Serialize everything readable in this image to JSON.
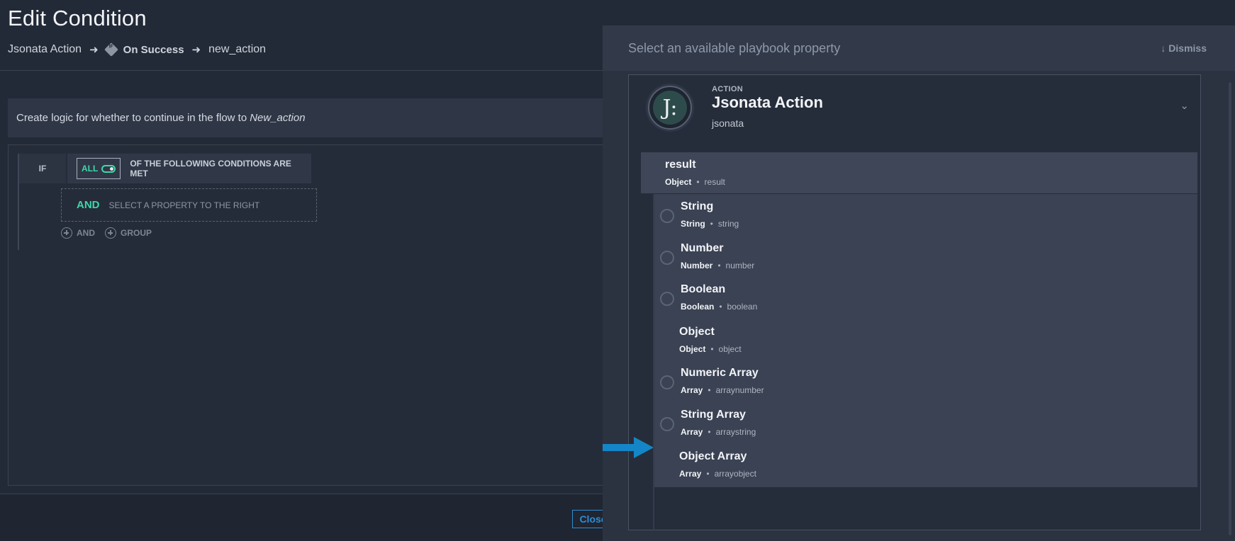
{
  "editor": {
    "title": "Edit Condition",
    "breadcrumb": {
      "source": "Jsonata Action",
      "sep1": "➜",
      "condition": "On Success",
      "sep2": "➜",
      "target": "new_action"
    },
    "intro_text": "Create logic for whether to continue in the flow to",
    "intro_target": "New_action",
    "if_label": "IF",
    "all_toggle_label": "ALL",
    "conditions_text": "OF THE FOLLOWING CONDITIONS ARE MET",
    "and_keyword": "AND",
    "and_hint": "SELECT A PROPERTY TO THE RIGHT",
    "add_and_label": "AND",
    "add_group_label": "GROUP",
    "close_label": "Close"
  },
  "panel": {
    "title": "Select an available playbook property",
    "dismiss_label": "↓ Dismiss",
    "action": {
      "kind": "ACTION",
      "name": "Jsonata Action",
      "id": "jsonata",
      "logo_glyph": "J:"
    },
    "root": {
      "name": "result",
      "type": "Object",
      "path": "result"
    },
    "properties": [
      {
        "name": "String",
        "type": "String",
        "path": "string",
        "selectable": true
      },
      {
        "name": "Number",
        "type": "Number",
        "path": "number",
        "selectable": true
      },
      {
        "name": "Boolean",
        "type": "Boolean",
        "path": "boolean",
        "selectable": true
      },
      {
        "name": "Object",
        "type": "Object",
        "path": "object",
        "selectable": false
      },
      {
        "name": "Numeric Array",
        "type": "Array",
        "path": "arraynumber",
        "selectable": true
      },
      {
        "name": "String Array",
        "type": "Array",
        "path": "arraystring",
        "selectable": true
      },
      {
        "name": "Object Array",
        "type": "Array",
        "path": "arrayobject",
        "selectable": false
      }
    ]
  },
  "colors": {
    "accent_green": "#3fd7a9",
    "accent_blue": "#2f8cd6",
    "pointer_arrow": "#1486c8"
  },
  "icons": {
    "breadcrumb_condition": "condition-diamond-icon",
    "add": "plus-circle-icon",
    "expand": "chevron-down-icon",
    "pointer": "arrow-right-icon"
  }
}
